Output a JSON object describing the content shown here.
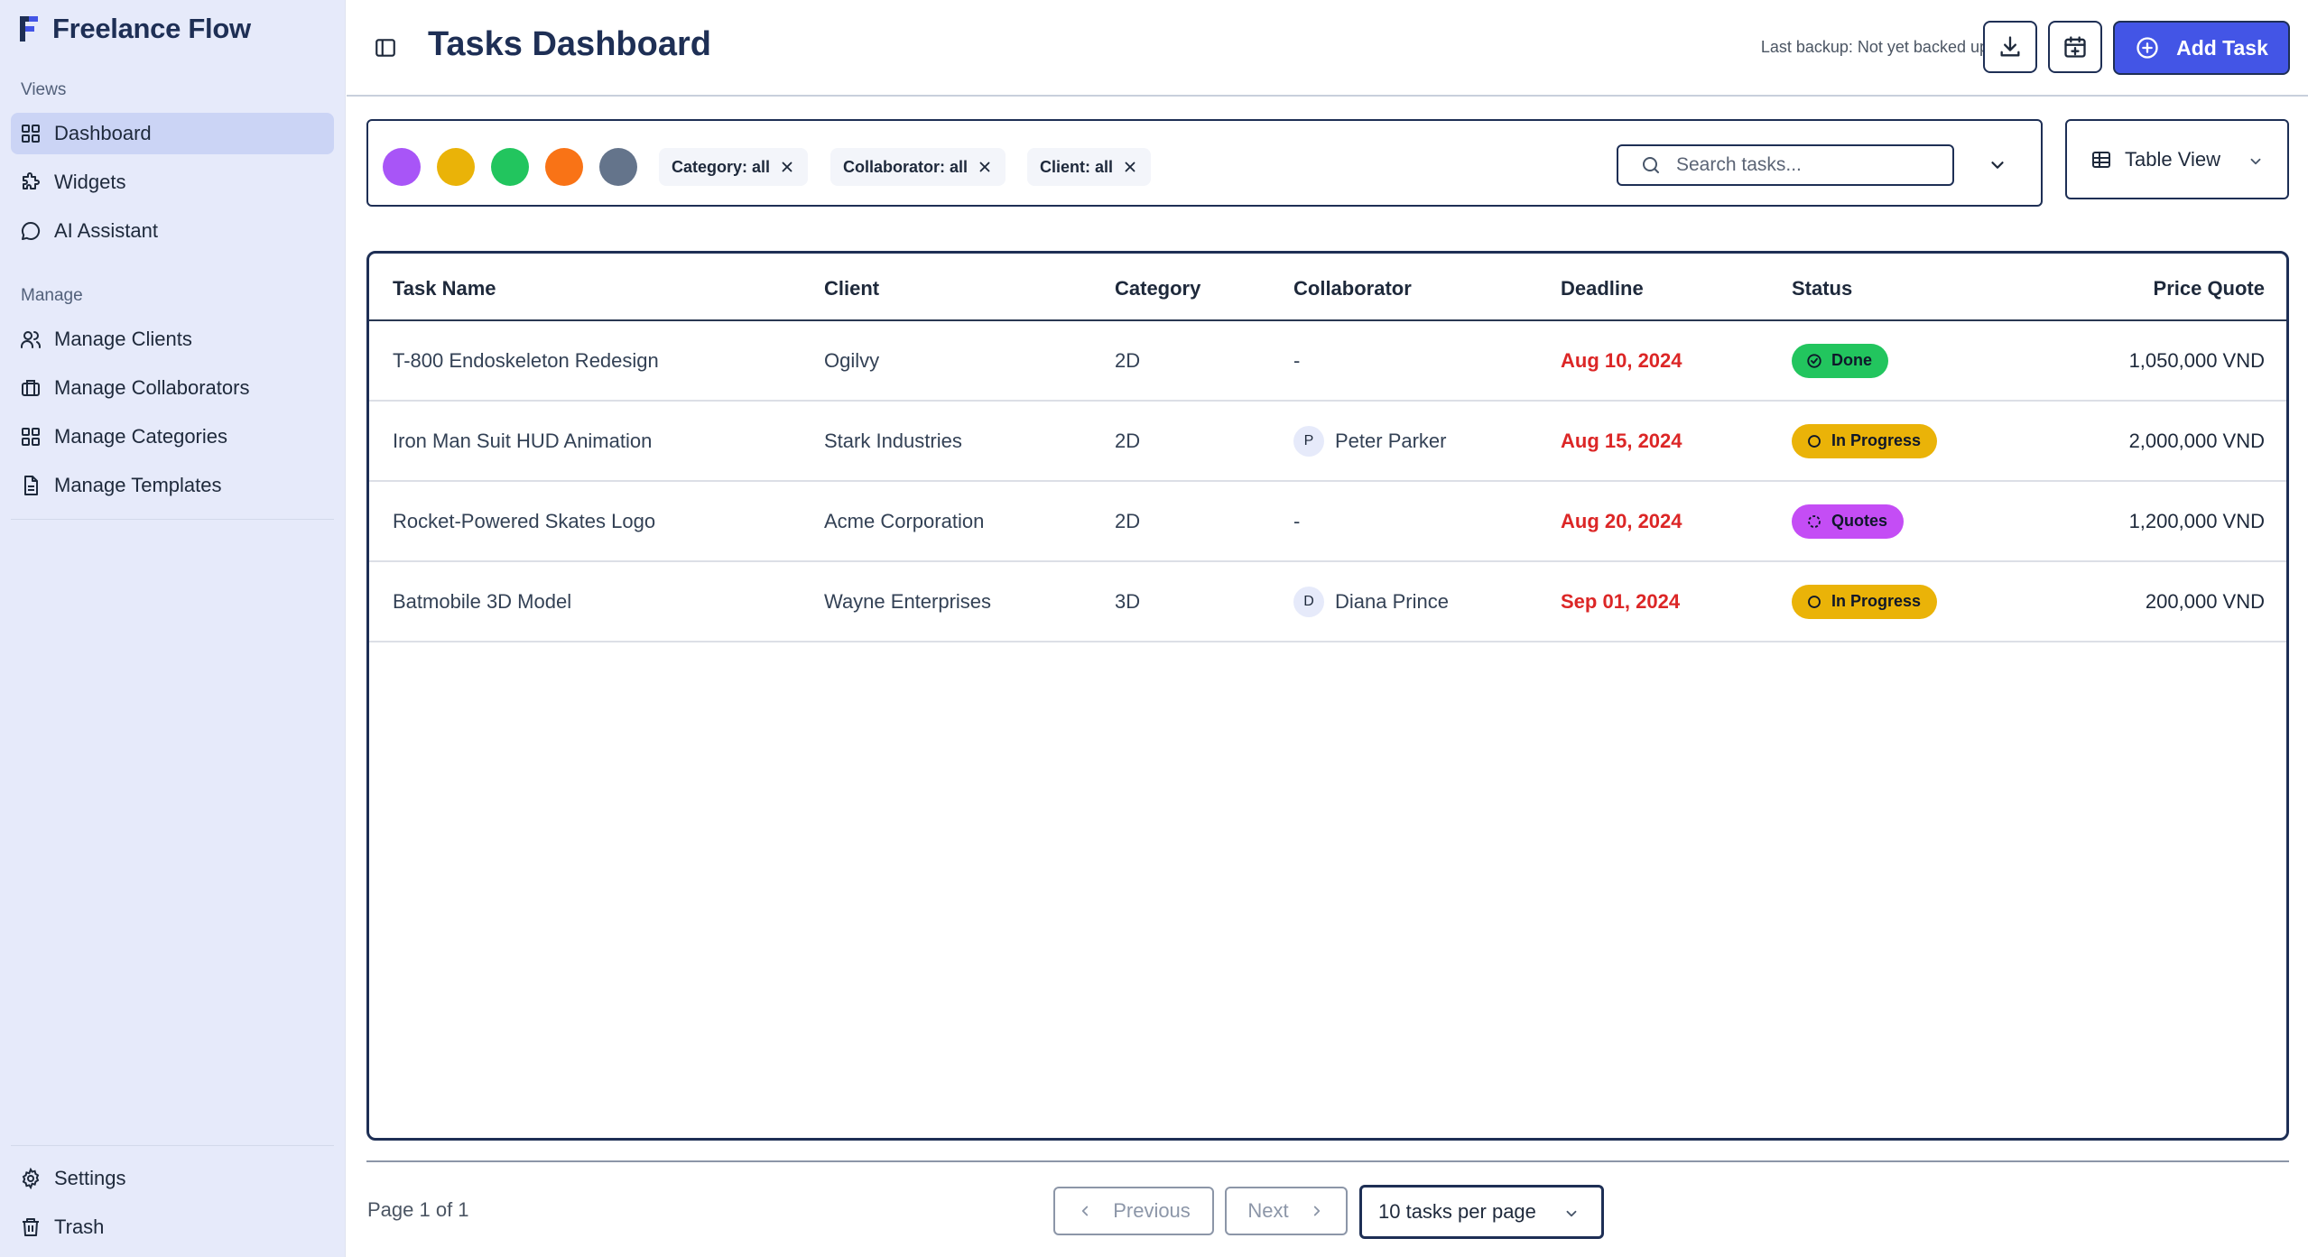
{
  "app": {
    "name": "Freelance Flow"
  },
  "sidebar": {
    "views_label": "Views",
    "manage_label": "Manage",
    "views": [
      {
        "label": "Dashboard",
        "icon": "grid-icon",
        "active": true
      },
      {
        "label": "Widgets",
        "icon": "puzzle-icon"
      },
      {
        "label": "AI Assistant",
        "icon": "chat-bubble-icon"
      }
    ],
    "manage": [
      {
        "label": "Manage Clients",
        "icon": "users-icon"
      },
      {
        "label": "Manage Collaborators",
        "icon": "briefcase-icon"
      },
      {
        "label": "Manage Categories",
        "icon": "grid-icon"
      },
      {
        "label": "Manage Templates",
        "icon": "document-icon"
      }
    ],
    "bottom": [
      {
        "label": "Settings",
        "icon": "gear-icon"
      },
      {
        "label": "Trash",
        "icon": "trash-icon"
      }
    ]
  },
  "header": {
    "title": "Tasks Dashboard",
    "backup_status": "Last backup: Not yet backed up",
    "add_task_label": "Add Task"
  },
  "filters": {
    "status_colors": [
      "#a855f7",
      "#eab308",
      "#22c55e",
      "#f97316",
      "#64748b"
    ],
    "chips": [
      {
        "label": "Category: all"
      },
      {
        "label": "Collaborator: all"
      },
      {
        "label": "Client: all"
      }
    ],
    "search_placeholder": "Search tasks...",
    "view_label": "Table View"
  },
  "table": {
    "columns": [
      "Task Name",
      "Client",
      "Category",
      "Collaborator",
      "Deadline",
      "Status",
      "Price Quote"
    ],
    "rows": [
      {
        "task": "T-800 Endoskeleton Redesign",
        "client": "Ogilvy",
        "category": "2D",
        "collaborator": "-",
        "collaborator_initial": "",
        "deadline": "Aug 10, 2024",
        "status": "Done",
        "status_color": "#22c55e",
        "price": "1,050,000 VND"
      },
      {
        "task": "Iron Man Suit HUD Animation",
        "client": "Stark Industries",
        "category": "2D",
        "collaborator": "Peter Parker",
        "collaborator_initial": "P",
        "deadline": "Aug 15, 2024",
        "status": "In Progress",
        "status_color": "#eab308",
        "price": "2,000,000 VND"
      },
      {
        "task": "Rocket-Powered Skates Logo",
        "client": "Acme Corporation",
        "category": "2D",
        "collaborator": "-",
        "collaborator_initial": "",
        "deadline": "Aug 20, 2024",
        "status": "Quotes",
        "status_color": "#c44df5",
        "price": "1,200,000 VND"
      },
      {
        "task": "Batmobile 3D Model",
        "client": "Wayne Enterprises",
        "category": "3D",
        "collaborator": "Diana Prince",
        "collaborator_initial": "D",
        "deadline": "Sep 01, 2024",
        "status": "In Progress",
        "status_color": "#eab308",
        "price": "200,000 VND"
      }
    ]
  },
  "pagination": {
    "page_info": "Page 1 of 1",
    "previous_label": "Previous",
    "next_label": "Next",
    "per_page_label": "10 tasks per page"
  },
  "theme": {
    "primary": "#4355e6",
    "border_dark": "#1e2f55",
    "sidebar_bg": "#e6eafa",
    "active_nav_bg": "#cbd4f5",
    "deadline_color": "#dc2626"
  }
}
